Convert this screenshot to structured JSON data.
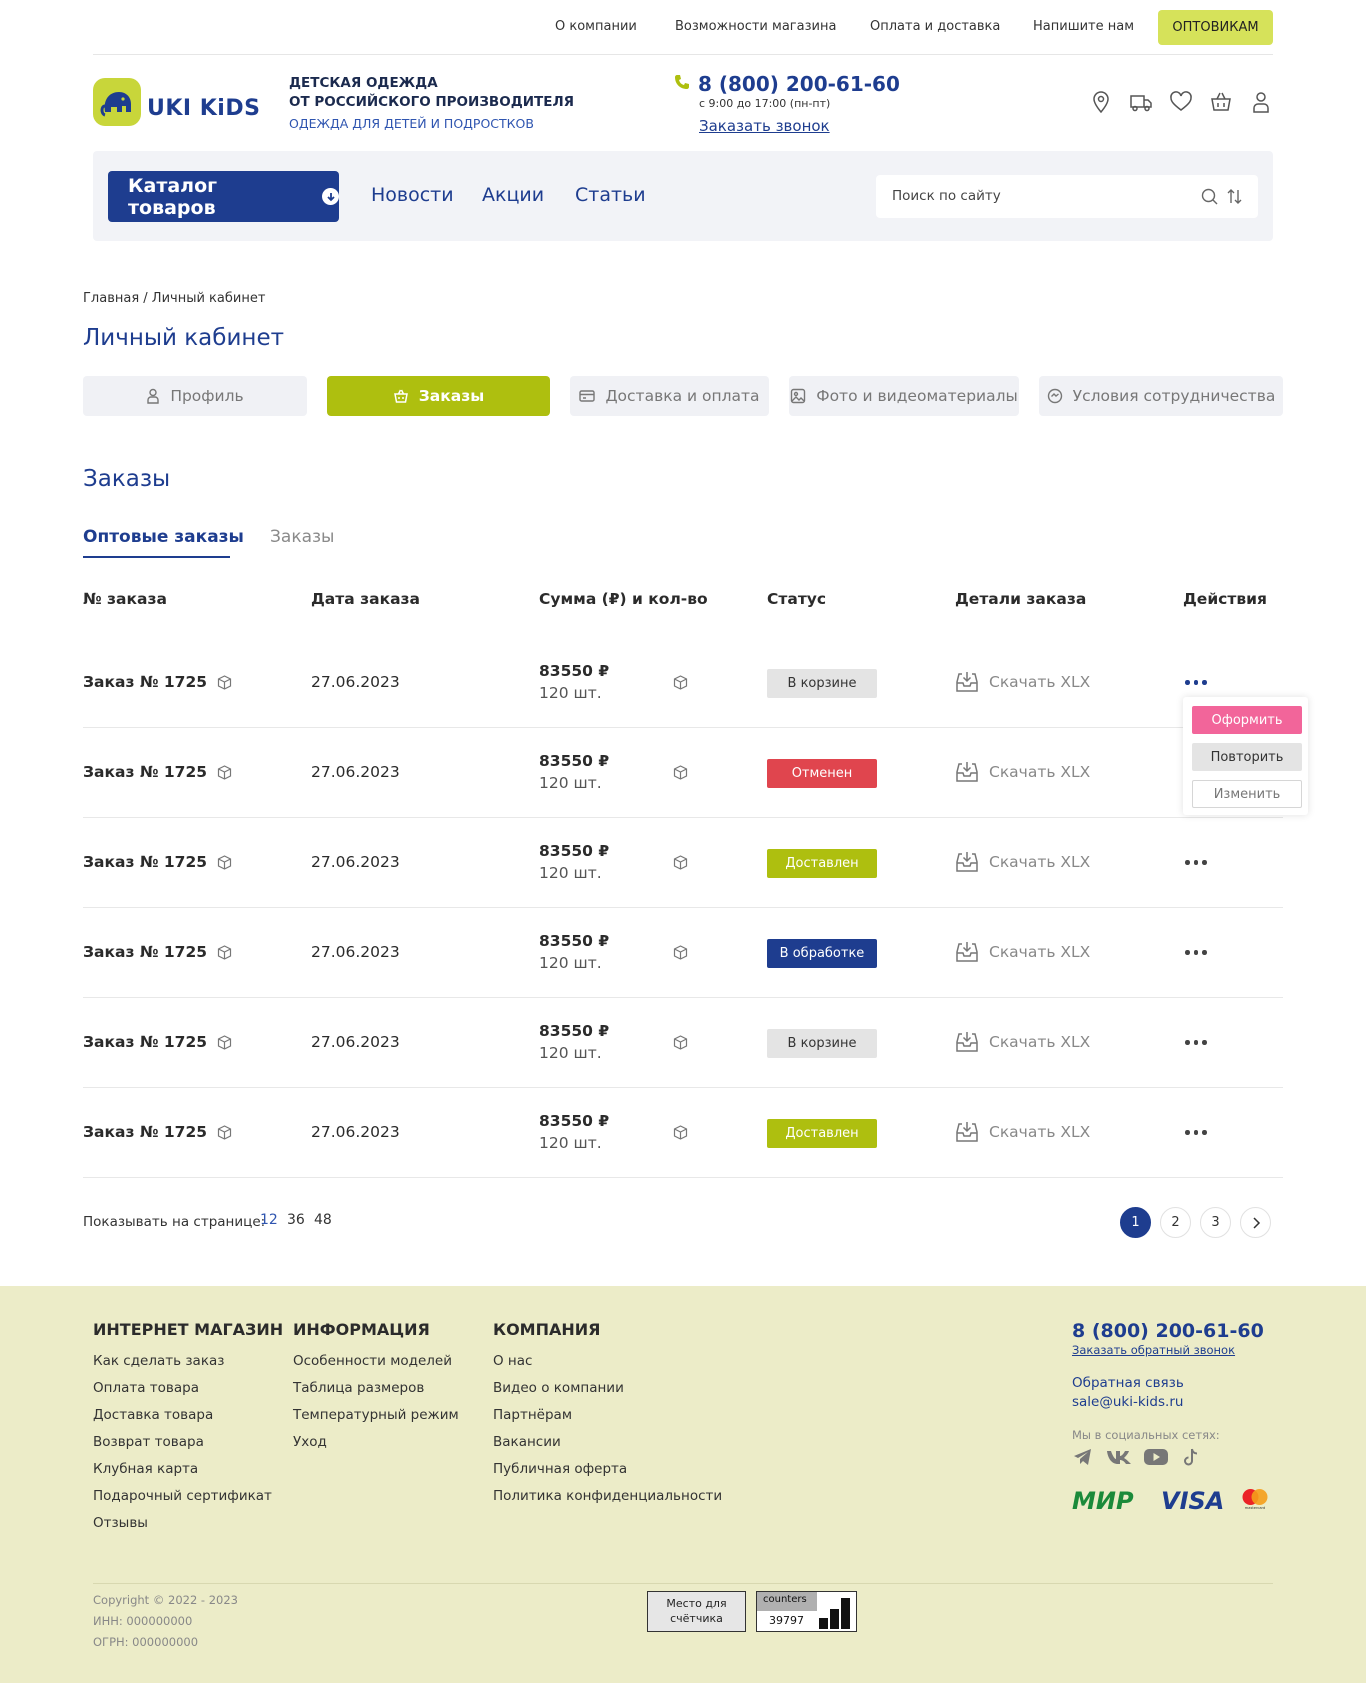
{
  "topnav": {
    "links": [
      "О компании",
      "Возможности магазина",
      "Оплата и доставка",
      "Напишите нам"
    ],
    "wholesale": "ОПТОВИКАМ"
  },
  "header": {
    "logo_text": "UKI KiDS",
    "tagline_line1": "ДЕТСКАЯ ОДЕЖДА",
    "tagline_line2": "ОТ РОССИЙСКОГО ПРОИЗВОДИТЕЛЯ",
    "tagline_sub": "ОДЕЖДА ДЛЯ ДЕТЕЙ И ПОДРОСТКОВ",
    "phone": "8 (800) 200-61-60",
    "hours": "с 9:00 до 17:00 (пн-пт)",
    "callback": "Заказать звонок",
    "icons": [
      "location-icon",
      "delivery-truck-icon",
      "heart-icon",
      "basket-icon",
      "user-icon"
    ]
  },
  "nav": {
    "catalog": "Каталог товаров",
    "links": [
      "Новости",
      "Акции",
      "Статьи"
    ],
    "search_placeholder": "Поиск по сайту"
  },
  "breadcrumb": "Главная / Личный кабинет",
  "page_title": "Личный кабинет",
  "profile_tabs": [
    {
      "label": "Профиль",
      "icon": "user-icon",
      "active": false
    },
    {
      "label": "Заказы",
      "icon": "basket-icon",
      "active": true
    },
    {
      "label": "Доставка и оплата",
      "icon": "card-icon",
      "active": false
    },
    {
      "label": "Фото и видеоматериалы",
      "icon": "image-icon",
      "active": false
    },
    {
      "label": "Условия сотрудничества",
      "icon": "handshake-icon",
      "active": false
    }
  ],
  "orders": {
    "title": "Заказы",
    "tabs": [
      "Оптовые заказы",
      "Заказы"
    ],
    "columns": [
      "№ заказа",
      "Дата заказа",
      "Сумма (₽) и кол-во",
      "Статус",
      "Детали заказа",
      "Действия"
    ],
    "rows": [
      {
        "number": "Заказ № 1725",
        "date": "27.06.2023",
        "sum": "83550 ₽",
        "qty": "120 шт.",
        "status": "В корзине",
        "details": "Скачать XLX"
      },
      {
        "number": "Заказ № 1725",
        "date": "27.06.2023",
        "sum": "83550 ₽",
        "qty": "120 шт.",
        "status": "Отменен",
        "details": "Скачать XLX"
      },
      {
        "number": "Заказ № 1725",
        "date": "27.06.2023",
        "sum": "83550 ₽",
        "qty": "120 шт.",
        "status": "Доставлен",
        "details": "Скачать XLX"
      },
      {
        "number": "Заказ № 1725",
        "date": "27.06.2023",
        "sum": "83550 ₽",
        "qty": "120 шт.",
        "status": "В обработке",
        "details": "Скачать XLX"
      },
      {
        "number": "Заказ № 1725",
        "date": "27.06.2023",
        "sum": "83550 ₽",
        "qty": "120 шт.",
        "status": "В корзине",
        "details": "Скачать XLX"
      },
      {
        "number": "Заказ № 1725",
        "date": "27.06.2023",
        "sum": "83550 ₽",
        "qty": "120 шт.",
        "status": "Доставлен",
        "details": "Скачать XLX"
      }
    ],
    "actions_menu": [
      "Оформить",
      "Повторить",
      "Изменить"
    ]
  },
  "status_colors": {
    "В корзине": {
      "bg": "#e4e4e4",
      "fg": "#333333"
    },
    "Отменен": {
      "bg": "#e0454e",
      "fg": "#ffffff"
    },
    "Доставлен": {
      "bg": "#aebf0f",
      "fg": "#ffffff"
    },
    "В обработке": {
      "bg": "#1e3d8f",
      "fg": "#ffffff"
    }
  },
  "pagination": {
    "per_page_label": "Показывать на странице:",
    "per_page_options": [
      "12",
      "36",
      "48"
    ],
    "pages": [
      "1",
      "2",
      "3"
    ],
    "current": "1"
  },
  "footer": {
    "col1_title": "ИНТЕРНЕТ МАГАЗИН",
    "col1": [
      "Как сделать заказ",
      "Оплата товара",
      "Доставка товара",
      "Возврат товара",
      "Клубная карта",
      "Подарочный сертификат",
      "Отзывы"
    ],
    "col2_title": "ИНФОРМАЦИЯ",
    "col2": [
      "Особенности моделей",
      "Таблица размеров",
      "Температурный режим",
      "Уход"
    ],
    "col3_title": "КОМПАНИЯ",
    "col3": [
      "О нас",
      "Видео о компании",
      "Партнёрам",
      "Вакансии",
      "Публичная оферта",
      "Политика конфиденциальности"
    ],
    "phone": "8 (800) 200-61-60",
    "callback": "Заказать обратный звонок",
    "feedback": "Обратная связь",
    "email": "sale@uki-kids.ru",
    "social_label": "Мы в социальных сетях:",
    "social_icons": [
      "telegram-icon",
      "vk-icon",
      "youtube-icon",
      "tiktok-icon"
    ],
    "payments": [
      "МИР",
      "VISA",
      "mastercard"
    ],
    "copyright": "Copyright © 2022 - 2023",
    "inn": "ИНН: 000000000",
    "ogrn": "ОГРН: 000000000",
    "counter_placeholder_1": "Место для",
    "counter_placeholder_2": "счётчика",
    "counter_label": "counters",
    "counter_value": "39797"
  },
  "colors": {
    "brand_blue": "#1e3d8f",
    "brand_green": "#aebf0f",
    "accent_yellow": "#d6e25a",
    "footer_bg": "#ececc8",
    "action_pink": "#f2659a"
  }
}
